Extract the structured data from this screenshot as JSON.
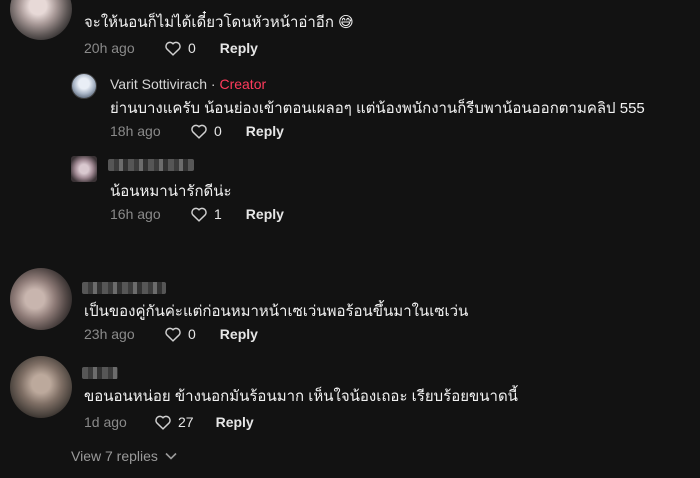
{
  "comments": [
    {
      "text": "จะให้นอนก็ไม่ได้เดี๋ยวโดนหัวหน้าอ่าอีก 😅",
      "time": "20h ago",
      "likes": "0",
      "reply_label": "Reply"
    },
    {
      "author": "Varit Sottivirach",
      "separator": " · ",
      "badge": "Creator",
      "text": "ย่านบางแครับ น้อนย่องเข้าตอนเผลอๆ แต่น้องพนักงานก็รีบพาน้อนออกตามคลิป 555",
      "time": "18h ago",
      "likes": "0",
      "reply_label": "Reply",
      "colors": {
        "badge": "#ff3b5c"
      }
    },
    {
      "text": "น้อนหมาน่ารักดีน่ะ",
      "time": "16h ago",
      "likes": "1",
      "reply_label": "Reply"
    },
    {
      "text": "เป็นของคู่กันค่ะแต่ก่อนหมาหน้าเซเว่นพอร้อนขึ้นมาในเซเว่น",
      "time": "23h ago",
      "likes": "0",
      "reply_label": "Reply"
    },
    {
      "text": "ขอนอนหน่อย ข้างนอกมันร้อนมาก เห็นใจน้องเถอะ เรียบร้อยขนาดนี้",
      "time": "1d ago",
      "likes": "27",
      "reply_label": "Reply"
    }
  ],
  "view_replies": "View 7 replies",
  "icons": {
    "like": "heart-outline-icon",
    "expand": "chevron-down-icon"
  },
  "colors": {
    "background": "#121212",
    "muted": "#8a8a8a"
  }
}
